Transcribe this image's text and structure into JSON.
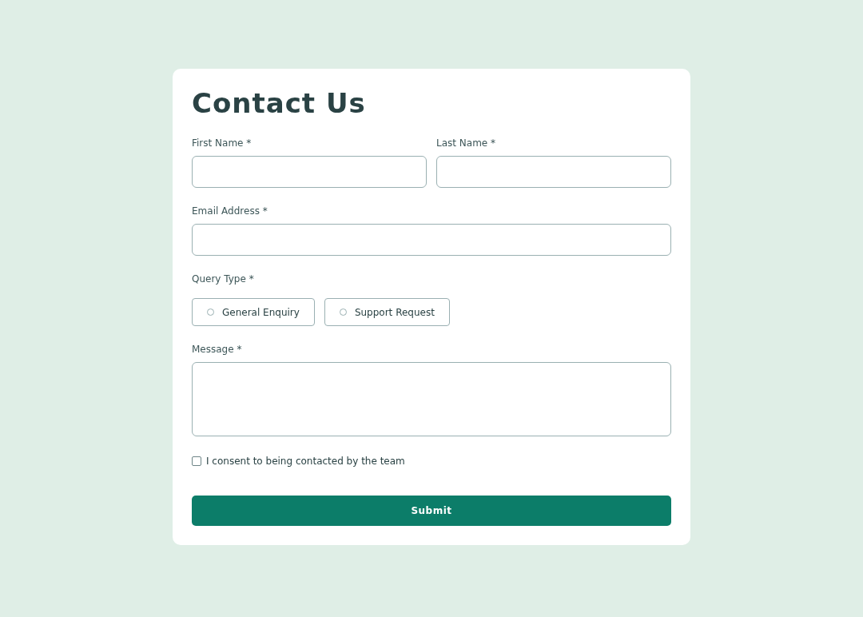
{
  "title": "Contact Us",
  "name_fields": [
    {
      "label": "First Name *"
    },
    {
      "label": "Last Name *"
    }
  ],
  "email": {
    "label": "Email Address *"
  },
  "query_type": {
    "label": "Query Type *",
    "options": [
      {
        "label": "General Enquiry",
        "selected": false
      },
      {
        "label": "Support Request",
        "selected": false
      }
    ]
  },
  "message": {
    "label": "Message *"
  },
  "consent": {
    "label": "I consent to being contacted by the team",
    "checked": false
  },
  "submit": "Submit"
}
